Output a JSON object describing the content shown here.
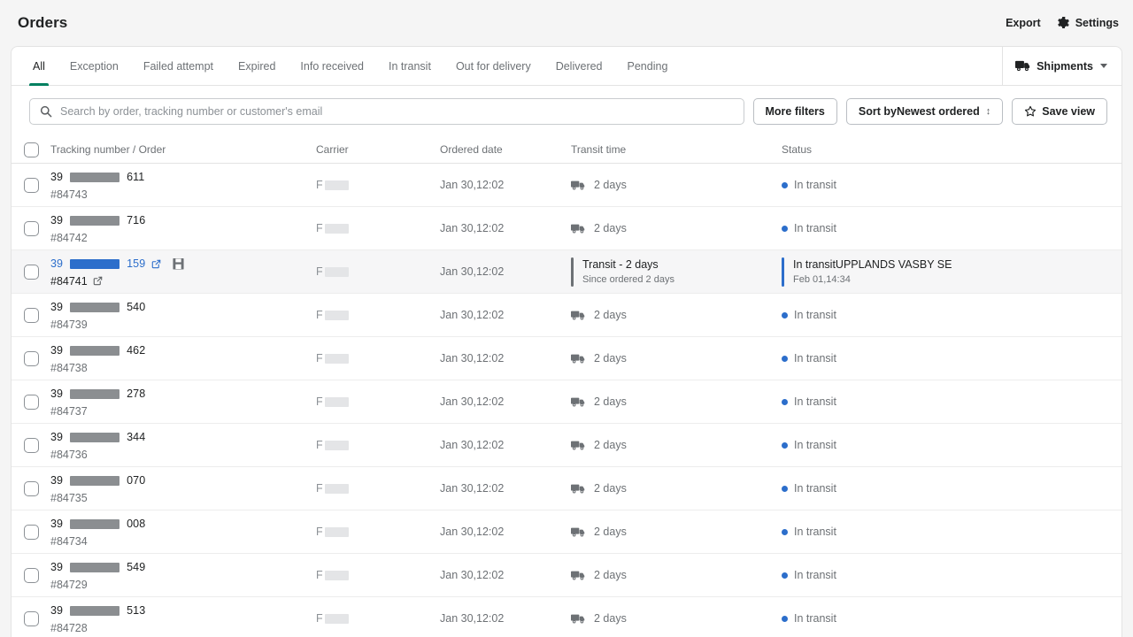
{
  "header": {
    "title": "Orders",
    "export_label": "Export",
    "settings_label": "Settings"
  },
  "tabs": [
    {
      "label": "All",
      "active": true
    },
    {
      "label": "Exception",
      "active": false
    },
    {
      "label": "Failed attempt",
      "active": false
    },
    {
      "label": "Expired",
      "active": false
    },
    {
      "label": "Info received",
      "active": false
    },
    {
      "label": "In transit",
      "active": false
    },
    {
      "label": "Out for delivery",
      "active": false
    },
    {
      "label": "Delivered",
      "active": false
    },
    {
      "label": "Pending",
      "active": false
    }
  ],
  "shipments_selector": {
    "label": "Shipments"
  },
  "filters": {
    "search_placeholder": "Search by order, tracking number or customer's email",
    "search_value": "",
    "more_filters_label": "More filters",
    "sort_label": "Sort byNewest ordered",
    "sort_arrows": "↕",
    "save_view_label": "Save view"
  },
  "table": {
    "columns": [
      "Tracking number / Order",
      "Carrier",
      "Ordered date",
      "Transit time",
      "Status"
    ],
    "rows": [
      {
        "tracking_prefix": "39",
        "tracking_suffix": "611",
        "order": "#84743",
        "carrier_prefix": "F",
        "ordered_date": "Jan 30,12:02",
        "transit_time": "2 days",
        "status": "In transit",
        "expanded": false
      },
      {
        "tracking_prefix": "39",
        "tracking_suffix": "716",
        "order": "#84742",
        "carrier_prefix": "F",
        "ordered_date": "Jan 30,12:02",
        "transit_time": "2 days",
        "status": "In transit",
        "expanded": false
      },
      {
        "tracking_prefix": "39",
        "tracking_suffix": "159",
        "order": "#84741",
        "carrier_prefix": "F",
        "ordered_date": "Jan 30,12:02",
        "transit_title": "Transit - 2 days",
        "transit_sub": "Since ordered 2 days",
        "status_title": "In transitUPPLANDS VASBY SE",
        "status_sub": "Feb 01,14:34",
        "expanded": true
      },
      {
        "tracking_prefix": "39",
        "tracking_suffix": "540",
        "order": "#84739",
        "carrier_prefix": "F",
        "ordered_date": "Jan 30,12:02",
        "transit_time": "2 days",
        "status": "In transit",
        "expanded": false
      },
      {
        "tracking_prefix": "39",
        "tracking_suffix": "462",
        "order": "#84738",
        "carrier_prefix": "F",
        "ordered_date": "Jan 30,12:02",
        "transit_time": "2 days",
        "status": "In transit",
        "expanded": false
      },
      {
        "tracking_prefix": "39",
        "tracking_suffix": "278",
        "order": "#84737",
        "carrier_prefix": "F",
        "ordered_date": "Jan 30,12:02",
        "transit_time": "2 days",
        "status": "In transit",
        "expanded": false
      },
      {
        "tracking_prefix": "39",
        "tracking_suffix": "344",
        "order": "#84736",
        "carrier_prefix": "F",
        "ordered_date": "Jan 30,12:02",
        "transit_time": "2 days",
        "status": "In transit",
        "expanded": false
      },
      {
        "tracking_prefix": "39",
        "tracking_suffix": "070",
        "order": "#84735",
        "carrier_prefix": "F",
        "ordered_date": "Jan 30,12:02",
        "transit_time": "2 days",
        "status": "In transit",
        "expanded": false
      },
      {
        "tracking_prefix": "39",
        "tracking_suffix": "008",
        "order": "#84734",
        "carrier_prefix": "F",
        "ordered_date": "Jan 30,12:02",
        "transit_time": "2 days",
        "status": "In transit",
        "expanded": false
      },
      {
        "tracking_prefix": "39",
        "tracking_suffix": "549",
        "order": "#84729",
        "carrier_prefix": "F",
        "ordered_date": "Jan 30,12:02",
        "transit_time": "2 days",
        "status": "In transit",
        "expanded": false
      },
      {
        "tracking_prefix": "39",
        "tracking_suffix": "513",
        "order": "#84728",
        "carrier_prefix": "F",
        "ordered_date": "Jan 30,12:02",
        "transit_time": "2 days",
        "status": "In transit",
        "expanded": false
      }
    ]
  },
  "colors": {
    "accent_green": "#008060",
    "link_blue": "#2c6ecb",
    "status_dot": "#2c6ecb",
    "page_bg": "#f5f5f5"
  }
}
